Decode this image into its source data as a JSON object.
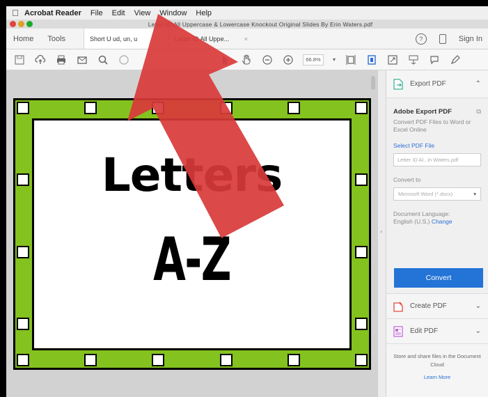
{
  "menubar": {
    "apple_icon": "apple-icon",
    "items": [
      "Acrobat Reader",
      "File",
      "Edit",
      "View",
      "Window",
      "Help"
    ]
  },
  "window": {
    "title": "Letter ID All Uppercase & Lowercase Knockout Original Slides By Erin Waters.pdf",
    "light_colors": [
      "#e0443e",
      "#dea123",
      "#1aab29"
    ]
  },
  "tabs": {
    "home": "Home",
    "tools": "Tools",
    "doc1": "Short U ud, un, u",
    "doc2": "Letter ID All Uppe...",
    "doc_close": "×",
    "sign_in": "Sign In"
  },
  "toolbar": {
    "zoom": "66.8%"
  },
  "slide": {
    "line1": "Letters",
    "line2": "A-Z",
    "colors": {
      "green": "#84c21f",
      "white": "#ffffff",
      "black": "#000000"
    }
  },
  "panel": {
    "export_pdf": "Export PDF",
    "export": {
      "heading": "Adobe Export PDF",
      "subtitle": "Convert PDF Files to Word or Excel Online",
      "select_link": "Select PDF File",
      "file_value": "Letter ID Al...in Waters.pdf",
      "convert_to_label": "Convert to",
      "format": "Microsoft Word (*.docx)",
      "language_label": "Document Language:",
      "language": "English (U.S.)",
      "change_link": "Change",
      "convert_button": "Convert"
    },
    "create_pdf": "Create PDF",
    "edit_pdf": "Edit PDF",
    "cloud_text": "Store and share files in the Document Cloud",
    "learn_more": "Learn More"
  },
  "overlay": {
    "arrow_color": "#d93a3a"
  }
}
